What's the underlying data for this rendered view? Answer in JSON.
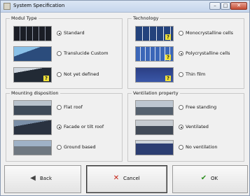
{
  "window": {
    "title": "System Specification"
  },
  "modul_type": {
    "title": "Modul Type",
    "options": [
      {
        "label": "Standard",
        "selected": true
      },
      {
        "label": "Translucide Custom",
        "selected": false
      },
      {
        "label": "Not yet defined",
        "selected": false
      }
    ]
  },
  "technology": {
    "title": "Technology",
    "options": [
      {
        "label": "Monocrystalline cells",
        "selected": false
      },
      {
        "label": "Polycrystalline cells",
        "selected": true
      },
      {
        "label": "Thin film",
        "selected": false
      }
    ]
  },
  "mounting": {
    "title": "Mounting disposition",
    "options": [
      {
        "label": "Flat roof",
        "selected": false
      },
      {
        "label": "Facade or tilt roof",
        "selected": true
      },
      {
        "label": "Ground based",
        "selected": false
      }
    ]
  },
  "ventilation": {
    "title": "Ventilation property",
    "options": [
      {
        "label": "Free standing",
        "selected": false
      },
      {
        "label": "Ventilated",
        "selected": true
      },
      {
        "label": "No ventilation",
        "selected": false
      }
    ]
  },
  "buttons": {
    "back": "Back",
    "cancel": "Cancel",
    "ok": "OK"
  }
}
